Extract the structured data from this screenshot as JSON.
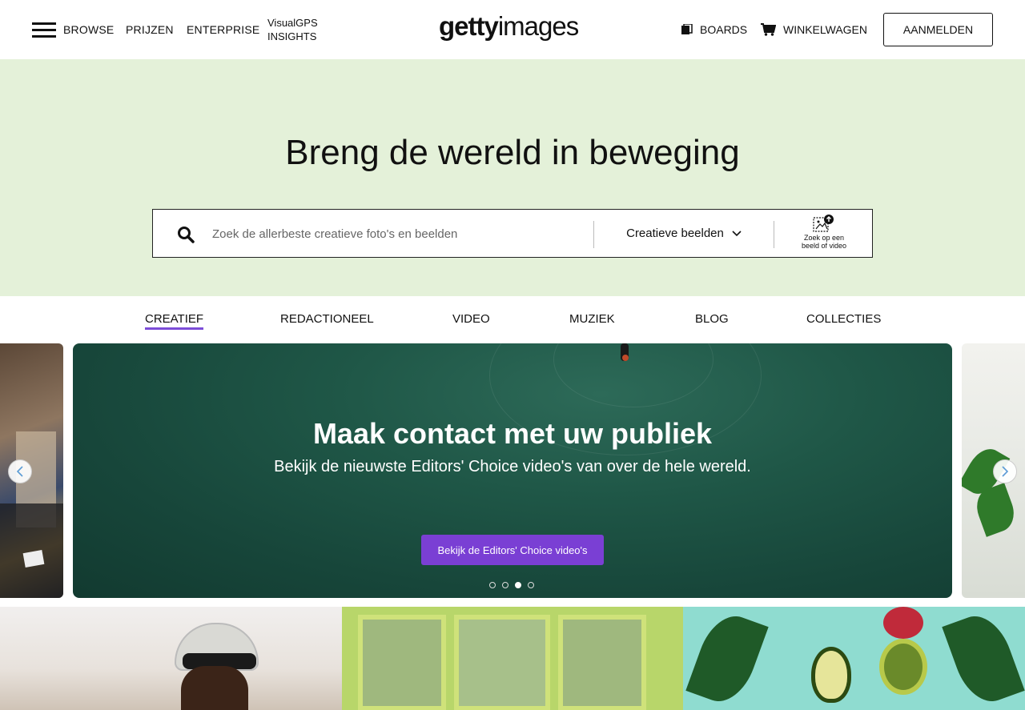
{
  "header": {
    "menu_icon": "hamburger-icon",
    "nav": [
      "BROWSE",
      "PRIJZEN",
      "ENTERPRISE"
    ],
    "visualgps_line1": "VisualGPS",
    "visualgps_line2": "INSIGHTS",
    "logo_bold": "getty",
    "logo_regular": "images",
    "boards_label": "BOARDS",
    "boards_icon": "boards-icon",
    "cart_label": "WINKELWAGEN",
    "cart_icon": "cart-icon",
    "signin_label": "AANMELDEN"
  },
  "hero": {
    "title": "Breng de wereld in beweging",
    "background": "#e4f1d9",
    "search": {
      "placeholder": "Zoek de allerbeste creatieve foto's en beelden",
      "value": "",
      "type_selected": "Creatieve beelden",
      "visual_search_line1": "Zoek op een",
      "visual_search_line2": "beeld of video"
    }
  },
  "tabs": [
    {
      "label": "CREATIEF",
      "active": true
    },
    {
      "label": "REDACTIONEEL",
      "active": false
    },
    {
      "label": "VIDEO",
      "active": false
    },
    {
      "label": "MUZIEK",
      "active": false
    },
    {
      "label": "BLOG",
      "active": false
    },
    {
      "label": "COLLECTIES",
      "active": false
    }
  ],
  "carousel": {
    "title": "Maak contact met uw publiek",
    "subtitle": "Bekijk de nieuwste Editors' Choice video's van over de hele wereld.",
    "cta": "Bekijk de Editors' Choice video's",
    "cta_color": "#7a3fd4",
    "slides_total": 4,
    "active_slide": 3,
    "prev_icon": "chevron-left-icon",
    "next_icon": "chevron-right-icon"
  },
  "accent_color": "#7c4dd8"
}
